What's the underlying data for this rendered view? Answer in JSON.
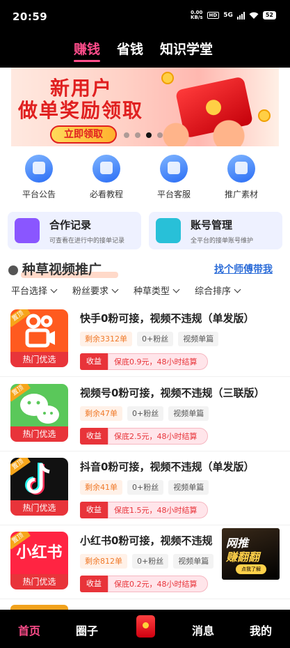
{
  "status_bar": {
    "time": "20:59",
    "net_speed_value": "0.00",
    "net_speed_unit": "KB/s",
    "hd": "HD",
    "network": "5G",
    "battery": "52"
  },
  "top_tabs": [
    {
      "label": "赚钱",
      "active": true
    },
    {
      "label": "省钱",
      "active": false
    },
    {
      "label": "知识学堂",
      "active": false
    }
  ],
  "banner": {
    "line1": "新用户",
    "line2": "做单奖励领取",
    "button": "立即领取",
    "slide_count": 4,
    "active_slide": 3
  },
  "quick_links": [
    {
      "label": "平台公告",
      "icon": "announcement-icon"
    },
    {
      "label": "必看教程",
      "icon": "tutorial-book-icon"
    },
    {
      "label": "平台客服",
      "icon": "customer-service-icon"
    },
    {
      "label": "推广素材",
      "icon": "promo-material-icon"
    }
  ],
  "cards": [
    {
      "title": "合作记录",
      "subtitle": "可查看在进行中的接单记录",
      "icon": "records-icon",
      "color": "#8a56ff"
    },
    {
      "title": "账号管理",
      "subtitle": "全平台的接单账号维护",
      "icon": "account-icon",
      "color": "#28c0d8"
    }
  ],
  "section": {
    "title": "种草视频推广",
    "link": "找个师傅带我"
  },
  "filters": [
    "平台选择",
    "粉丝要求",
    "种草类型",
    "综合排序"
  ],
  "tasks": [
    {
      "title": "快手0粉可接，视频不违规（单发版）",
      "thumb_tag": "热门优选",
      "pinned": "置顶",
      "platform_icon": "kuaishou-logo-icon",
      "remain": "剩余3312单",
      "fans": "0+粉丝",
      "type": "视频单篇",
      "income_label": "收益",
      "income_text": "保底0.9元，48小时结算"
    },
    {
      "title": "视频号0粉可接，视频不违规（三联版）",
      "thumb_tag": "热门优选",
      "pinned": "置顶",
      "platform_icon": "wechat-channels-logo-icon",
      "remain": "剩余47单",
      "fans": "0+粉丝",
      "type": "视频单篇",
      "income_label": "收益",
      "income_text": "保底2.5元，48小时结算"
    },
    {
      "title": "抖音0粉可接，视频不违规（单发版）",
      "thumb_tag": "热门优选",
      "pinned": "置顶",
      "platform_icon": "douyin-logo-icon",
      "remain": "剩余41单",
      "fans": "0+粉丝",
      "type": "视频单篇",
      "income_label": "收益",
      "income_text": "保底1.5元，48小时结算"
    },
    {
      "title": "小红书0粉可接，视频不违规",
      "thumb_tag": "热门优选",
      "pinned": "置顶",
      "platform_icon": "xiaohongshu-logo-icon",
      "thumb_text": "小红书",
      "remain": "剩余812单",
      "fans": "0+粉丝",
      "type": "视频单篇",
      "income_label": "收益",
      "income_text": "保底0.2元，48小时结算"
    }
  ],
  "float_ad": {
    "line1": "网推",
    "line2": "赚翻翻",
    "button": "点我了解"
  },
  "bottom_nav": [
    {
      "label": "首页",
      "active": true
    },
    {
      "label": "圈子",
      "active": false
    },
    {
      "label": "",
      "icon": "red-envelope-icon"
    },
    {
      "label": "消息",
      "active": false
    },
    {
      "label": "我的",
      "active": false
    }
  ]
}
